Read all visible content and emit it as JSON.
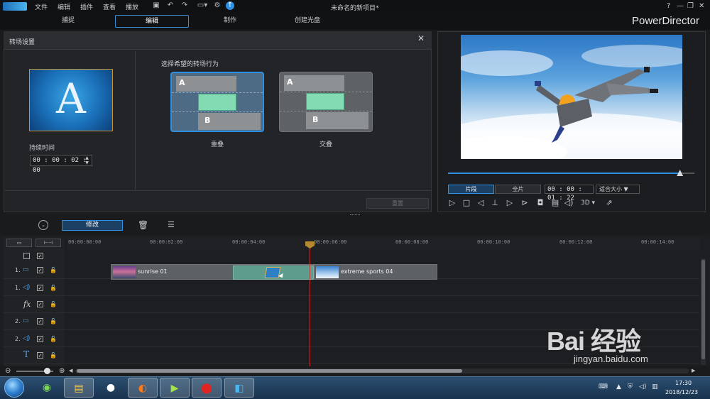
{
  "menu": [
    "文件",
    "编辑",
    "插件",
    "查看",
    "播放"
  ],
  "document_title": "未命名的新项目*",
  "window_controls": [
    "?",
    "—",
    "❐",
    "✕"
  ],
  "modes": {
    "capture": "捕捉",
    "edit": "编辑",
    "produce": "制作",
    "disc": "创建光盘",
    "active": "编辑"
  },
  "brand": "PowerDirector",
  "settings": {
    "title": "转场设置",
    "thumb_letter": "A",
    "duration_label": "持续时间",
    "duration_value": "00 : 00 : 02 : 00",
    "behavior_label": "选择希望的转场行为",
    "option_overlap": "重叠",
    "option_cross": "交叠",
    "card_a": "A",
    "card_b": "B",
    "reset": "重置"
  },
  "preview": {
    "toggle_clip": "片段",
    "toggle_movie": "全片",
    "time": "00 : 00 : 01 : 22",
    "fit": "适合大小 ▼",
    "three_d": "3D ▾",
    "playback_progress": 0.94
  },
  "toolbar": {
    "modify": "修改"
  },
  "ruler_ticks": [
    "00:00:00:00",
    "00:00:02:00",
    "00:00:04:00",
    "00:00:06:00",
    "00:00:08:00",
    "00:00:10:00",
    "00:00:12:00",
    "00:00:14:00"
  ],
  "tracks": [
    {
      "num": "1.",
      "icon": "video-track-icon"
    },
    {
      "num": "1.",
      "icon": "audio-track-icon"
    },
    {
      "num": "",
      "icon": "fx-track-icon",
      "label": "fx"
    },
    {
      "num": "2.",
      "icon": "video-track-icon"
    },
    {
      "num": "2.",
      "icon": "audio-track-icon"
    },
    {
      "num": "",
      "icon": "title-track-icon",
      "label": "T"
    }
  ],
  "clips": {
    "clip1": "sunrise 01",
    "clip2": "extreme sports 04"
  },
  "taskbar": {
    "clock_time": "17:30",
    "clock_date": "2018/12/23"
  },
  "watermark": {
    "main": "Bai 经验",
    "sub": "jingyan.baidu.com"
  },
  "colors": {
    "accent": "#2f8fe0",
    "playhead": "#c23b3b",
    "transition": "#5e9c8c"
  }
}
